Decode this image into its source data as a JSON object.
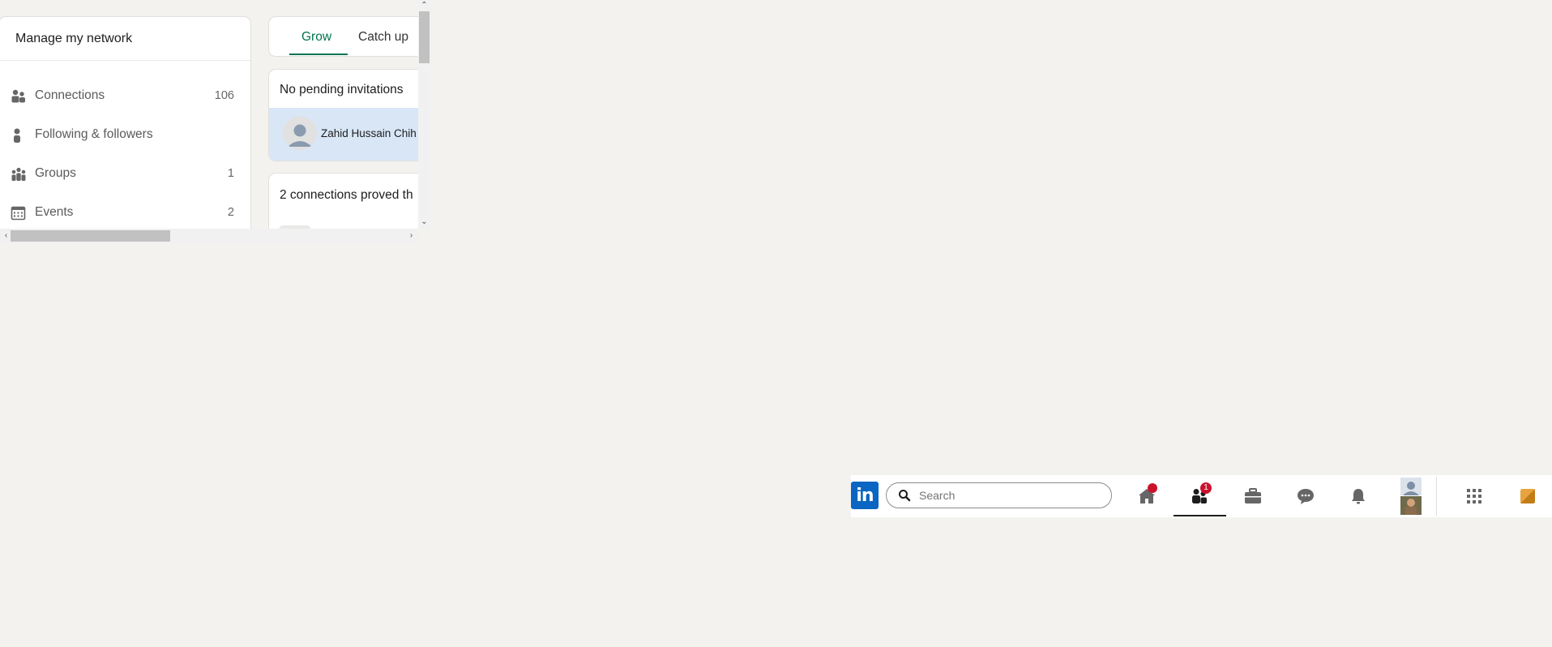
{
  "sidebar": {
    "title": "Manage my network",
    "items": [
      {
        "label": "Connections",
        "count": "106",
        "icon": "people-icon"
      },
      {
        "label": "Following & followers",
        "count": "",
        "icon": "person-icon"
      },
      {
        "label": "Groups",
        "count": "1",
        "icon": "groups-icon"
      },
      {
        "label": "Events",
        "count": "2",
        "icon": "calendar-icon"
      }
    ]
  },
  "tabs": {
    "items": [
      {
        "label": "Grow",
        "active": true
      },
      {
        "label": "Catch up",
        "active": false
      }
    ]
  },
  "invitations": {
    "title": "No pending invitations",
    "person_name": "Zahid Hussain Chih"
  },
  "proved": {
    "title": "2 connections proved th"
  },
  "topnav": {
    "logo_text": "in",
    "search_placeholder": "Search",
    "network_badge": "1",
    "icons": [
      "home-icon",
      "my-network-icon",
      "jobs-icon",
      "messaging-icon",
      "notifications-icon",
      "me-avatar",
      "work-grid-icon",
      "premium-icon"
    ]
  },
  "colors": {
    "brand": "#0a66c2",
    "accent_green": "#01754f",
    "badge_red": "#cb112d",
    "background": "#f3f2ef"
  }
}
